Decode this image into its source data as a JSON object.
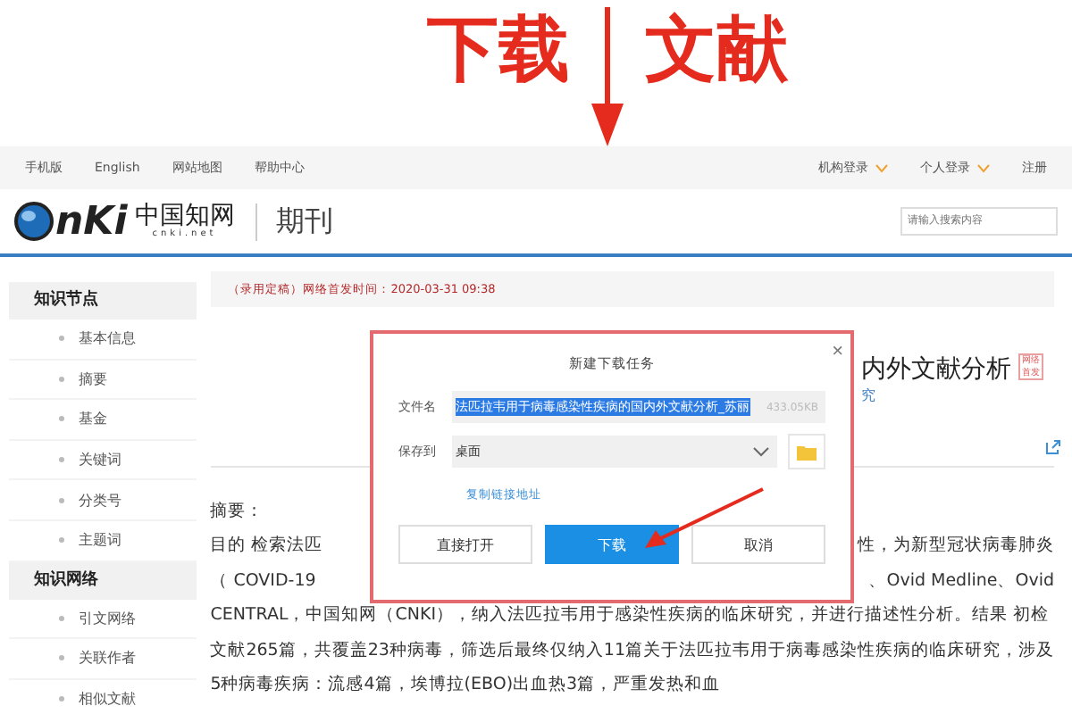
{
  "annotation": {
    "texts": [
      "下载",
      "文献"
    ]
  },
  "nav": {
    "left": [
      "手机版",
      "English",
      "网站地图",
      "帮助中心"
    ],
    "right": [
      {
        "label": "机构登录",
        "dropdown": true
      },
      {
        "label": "个人登录",
        "dropdown": true
      },
      {
        "label": "注册",
        "dropdown": false
      }
    ]
  },
  "header": {
    "logo": {
      "letters": "nKi",
      "chinese": "中国知网",
      "domain": "cnki.net"
    },
    "section": "期刊",
    "search": {
      "placeholder": "请输入搜索内容"
    }
  },
  "sidebar": [
    {
      "title": "知识节点",
      "items": [
        "基本信息",
        "摘要",
        "基金",
        "关键词",
        "分类号",
        "主题词"
      ]
    },
    {
      "title": "知识网络",
      "items": [
        "引文网络",
        "关联作者",
        "相似文献"
      ]
    }
  ],
  "notice": "（录用定稿）网络首发时间：2020-03-31 09:38",
  "article": {
    "title": "内外文献分析",
    "badge": "网络首发",
    "author": "究"
  },
  "abstract": {
    "label": "摘要：",
    "lines": [
      {
        "left": "目的 检索法匹",
        "right": "性，为新型冠状病毒肺炎"
      },
      {
        "left": "（ COVID-19",
        "right": "、Ovid Medline、Ovid"
      },
      {
        "left": "CENTRAL，中国知网（CNKI），纳入法匹拉韦用于感染性疾病的临床研究，并进行描述性分析。结果 初检"
      },
      {
        "left": "文献265篇，共覆盖23种病毒，筛选后最终仅纳入11篇关于法匹拉韦用于病毒感染性疾病的临床研究，涉及"
      },
      {
        "left": "5种病毒疾病：流感4篇，埃博拉(EBO)出血热3篇，严重发热和血"
      }
    ]
  },
  "dialog": {
    "title": "新建下载任务",
    "close": "×",
    "file_label": "文件名",
    "file_value": "法匹拉韦用于病毒感染性疾病的国内外文献分析_苏丽",
    "text_selected": true,
    "file_size": "433.05KB",
    "save_label": "保存到",
    "save_value": "桌面",
    "link": "复制链接地址",
    "buttons": [
      {
        "label": "直接打开",
        "primary": false
      },
      {
        "label": "下载",
        "primary": true
      },
      {
        "label": "取消",
        "primary": false
      }
    ]
  }
}
